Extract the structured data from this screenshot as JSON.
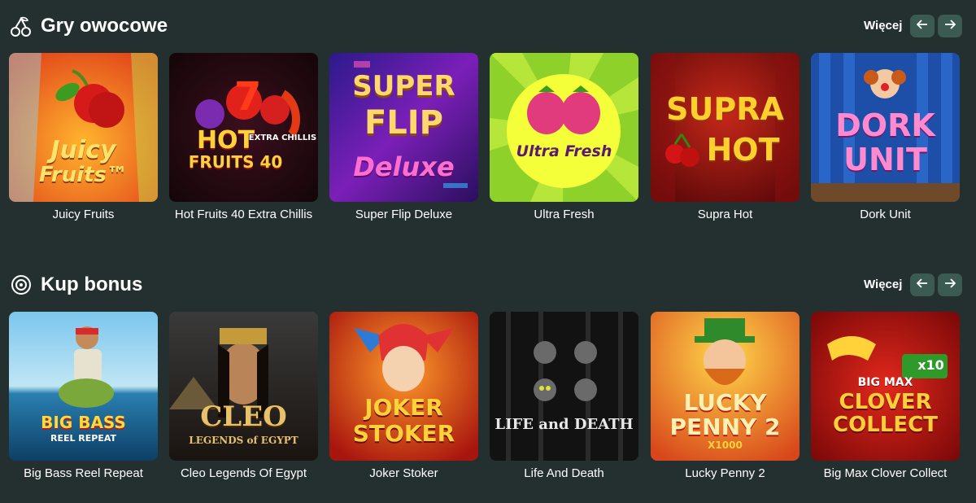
{
  "sections": [
    {
      "title": "Gry owocowe",
      "icon": "cherry-icon",
      "more_label": "Więcej",
      "games": [
        {
          "title": "Juicy Fruits",
          "art_lines": [
            "Juicy",
            "Fruits™"
          ]
        },
        {
          "title": "Hot Fruits 40 Extra Chillis",
          "art_lines": [
            "HOT",
            "FRUITS 40",
            "EXTRA CHILLIS"
          ]
        },
        {
          "title": "Super Flip Deluxe",
          "art_lines": [
            "SUPER",
            "FLIP",
            "Deluxe"
          ]
        },
        {
          "title": "Ultra Fresh",
          "art_lines": [
            "Ultra Fresh"
          ]
        },
        {
          "title": "Supra Hot",
          "art_lines": [
            "SUPRA",
            "HOT"
          ]
        },
        {
          "title": "Dork Unit",
          "art_lines": [
            "DORK",
            "UNIT"
          ]
        }
      ]
    },
    {
      "title": "Kup bonus",
      "icon": "target-coin-icon",
      "more_label": "Więcej",
      "games": [
        {
          "title": "Big Bass Reel Repeat",
          "art_lines": [
            "BIG BASS",
            "REEL REPEAT"
          ]
        },
        {
          "title": "Cleo Legends Of Egypt",
          "art_lines": [
            "CLEO",
            "LEGENDS of EGYPT"
          ]
        },
        {
          "title": "Joker Stoker",
          "art_lines": [
            "JOKER",
            "STOKER"
          ]
        },
        {
          "title": "Life And Death",
          "art_lines": [
            "LIFE and DEATH"
          ]
        },
        {
          "title": "Lucky Penny 2",
          "art_lines": [
            "LUCKY",
            "PENNY 2",
            "X1000"
          ]
        },
        {
          "title": "Big Max Clover Collect",
          "art_lines": [
            "BIG MAX",
            "CLOVER",
            "COLLECT",
            "x10"
          ]
        }
      ]
    }
  ],
  "colors": {
    "background": "#243030",
    "nav_button": "#3a5a52",
    "text": "#ffffff"
  }
}
